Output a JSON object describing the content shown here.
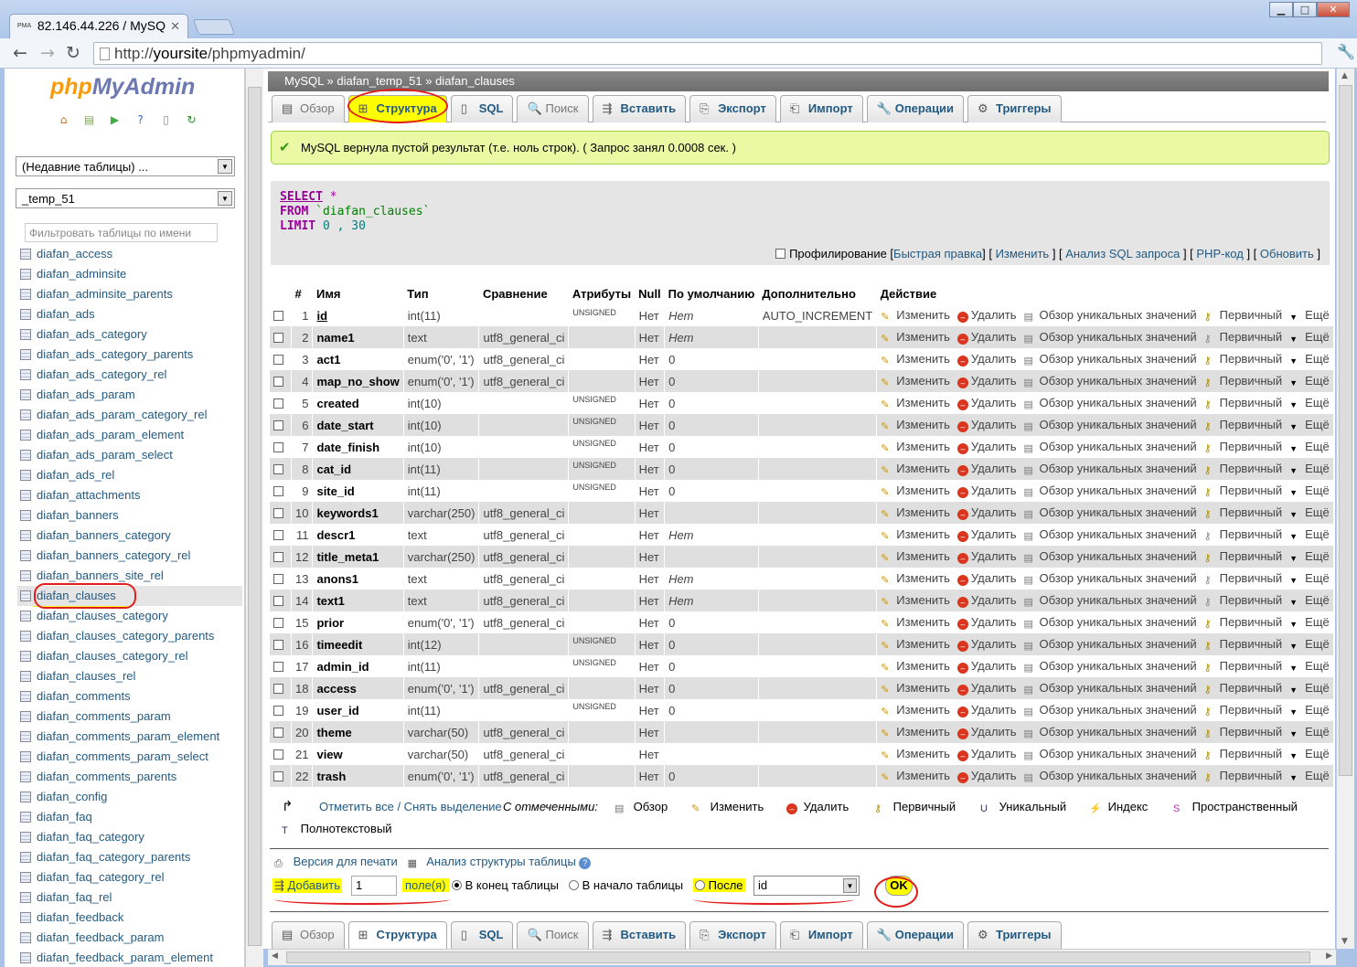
{
  "browser": {
    "tab_title": "82.146.44.226 / MySQ",
    "tab_favicon": "PMA",
    "url_prefix": "http://",
    "url_domain": "yoursite",
    "url_path": "/phpmyadmin/"
  },
  "sidebar": {
    "logo_php": "php",
    "logo_myadmin": "MyAdmin",
    "recent_select": "(Недавние таблицы) ...",
    "db_select": "_temp_51",
    "filter_placeholder": "Фильтровать таблицы по имени",
    "tables": [
      "diafan_access",
      "diafan_adminsite",
      "diafan_adminsite_parents",
      "diafan_ads",
      "diafan_ads_category",
      "diafan_ads_category_parents",
      "diafan_ads_category_rel",
      "diafan_ads_param",
      "diafan_ads_param_category_rel",
      "diafan_ads_param_element",
      "diafan_ads_param_select",
      "diafan_ads_rel",
      "diafan_attachments",
      "diafan_banners",
      "diafan_banners_category",
      "diafan_banners_category_rel",
      "diafan_banners_site_rel",
      "diafan_clauses",
      "diafan_clauses_category",
      "diafan_clauses_category_parents",
      "diafan_clauses_category_rel",
      "diafan_clauses_rel",
      "diafan_comments",
      "diafan_comments_param",
      "diafan_comments_param_element",
      "diafan_comments_param_select",
      "diafan_comments_parents",
      "diafan_config",
      "diafan_faq",
      "diafan_faq_category",
      "diafan_faq_category_parents",
      "diafan_faq_category_rel",
      "diafan_faq_rel",
      "diafan_feedback",
      "diafan_feedback_param",
      "diafan_feedback_param_element"
    ],
    "selected_table": "diafan_clauses"
  },
  "breadcrumb": {
    "server": "MySQL",
    "db": "diafan_temp_51",
    "table": "diafan_clauses",
    "sep": "»"
  },
  "tabs": [
    {
      "label": "Обзор",
      "icon": "browse-icon",
      "disabled": true
    },
    {
      "label": "Структура",
      "icon": "structure-icon",
      "active": true
    },
    {
      "label": "SQL",
      "icon": "sql-icon"
    },
    {
      "label": "Поиск",
      "icon": "search-icon",
      "disabled": true
    },
    {
      "label": "Вставить",
      "icon": "insert-icon"
    },
    {
      "label": "Экспорт",
      "icon": "export-icon"
    },
    {
      "label": "Импорт",
      "icon": "import-icon"
    },
    {
      "label": "Операции",
      "icon": "operations-icon"
    },
    {
      "label": "Триггеры",
      "icon": "triggers-icon"
    }
  ],
  "message": "MySQL вернула пустой результат (т.е. ноль строк). ( Запрос занял 0.0008 сек. )",
  "sql": {
    "kw_select": "SELECT",
    "star": " *",
    "kw_from": "FROM",
    "table": " `diafan_clauses`",
    "kw_limit": "LIMIT",
    "limit": " 0 , 30",
    "profiling": "Профилирование",
    "links": [
      "Быстрая правка",
      "Изменить",
      "Анализ SQL запроса",
      "PHP-код",
      "Обновить"
    ]
  },
  "table_headers": [
    "#",
    "Имя",
    "Тип",
    "Сравнение",
    "Атрибуты",
    "Null",
    "По умолчанию",
    "Дополнительно",
    "Действие"
  ],
  "columns": [
    {
      "n": "1",
      "name": "id",
      "type": "int(11)",
      "coll": "",
      "attr": "UNSIGNED",
      "null": "Нет",
      "def": "Нет",
      "extra": "AUTO_INCREMENT"
    },
    {
      "n": "2",
      "name": "name1",
      "type": "text",
      "coll": "utf8_general_ci",
      "attr": "",
      "null": "Нет",
      "def": "Нет",
      "extra": ""
    },
    {
      "n": "3",
      "name": "act1",
      "type": "enum('0', '1')",
      "coll": "utf8_general_ci",
      "attr": "",
      "null": "Нет",
      "def": "0",
      "extra": ""
    },
    {
      "n": "4",
      "name": "map_no_show",
      "type": "enum('0', '1')",
      "coll": "utf8_general_ci",
      "attr": "",
      "null": "Нет",
      "def": "0",
      "extra": ""
    },
    {
      "n": "5",
      "name": "created",
      "type": "int(10)",
      "coll": "",
      "attr": "UNSIGNED",
      "null": "Нет",
      "def": "0",
      "extra": ""
    },
    {
      "n": "6",
      "name": "date_start",
      "type": "int(10)",
      "coll": "",
      "attr": "UNSIGNED",
      "null": "Нет",
      "def": "0",
      "extra": ""
    },
    {
      "n": "7",
      "name": "date_finish",
      "type": "int(10)",
      "coll": "",
      "attr": "UNSIGNED",
      "null": "Нет",
      "def": "0",
      "extra": ""
    },
    {
      "n": "8",
      "name": "cat_id",
      "type": "int(11)",
      "coll": "",
      "attr": "UNSIGNED",
      "null": "Нет",
      "def": "0",
      "extra": ""
    },
    {
      "n": "9",
      "name": "site_id",
      "type": "int(11)",
      "coll": "",
      "attr": "UNSIGNED",
      "null": "Нет",
      "def": "0",
      "extra": ""
    },
    {
      "n": "10",
      "name": "keywords1",
      "type": "varchar(250)",
      "coll": "utf8_general_ci",
      "attr": "",
      "null": "Нет",
      "def": "",
      "extra": ""
    },
    {
      "n": "11",
      "name": "descr1",
      "type": "text",
      "coll": "utf8_general_ci",
      "attr": "",
      "null": "Нет",
      "def": "Нет",
      "extra": ""
    },
    {
      "n": "12",
      "name": "title_meta1",
      "type": "varchar(250)",
      "coll": "utf8_general_ci",
      "attr": "",
      "null": "Нет",
      "def": "",
      "extra": ""
    },
    {
      "n": "13",
      "name": "anons1",
      "type": "text",
      "coll": "utf8_general_ci",
      "attr": "",
      "null": "Нет",
      "def": "Нет",
      "extra": ""
    },
    {
      "n": "14",
      "name": "text1",
      "type": "text",
      "coll": "utf8_general_ci",
      "attr": "",
      "null": "Нет",
      "def": "Нет",
      "extra": ""
    },
    {
      "n": "15",
      "name": "prior",
      "type": "enum('0', '1')",
      "coll": "utf8_general_ci",
      "attr": "",
      "null": "Нет",
      "def": "0",
      "extra": ""
    },
    {
      "n": "16",
      "name": "timeedit",
      "type": "int(12)",
      "coll": "",
      "attr": "UNSIGNED",
      "null": "Нет",
      "def": "0",
      "extra": ""
    },
    {
      "n": "17",
      "name": "admin_id",
      "type": "int(11)",
      "coll": "",
      "attr": "UNSIGNED",
      "null": "Нет",
      "def": "0",
      "extra": ""
    },
    {
      "n": "18",
      "name": "access",
      "type": "enum('0', '1')",
      "coll": "utf8_general_ci",
      "attr": "",
      "null": "Нет",
      "def": "0",
      "extra": ""
    },
    {
      "n": "19",
      "name": "user_id",
      "type": "int(11)",
      "coll": "",
      "attr": "UNSIGNED",
      "null": "Нет",
      "def": "0",
      "extra": ""
    },
    {
      "n": "20",
      "name": "theme",
      "type": "varchar(50)",
      "coll": "utf8_general_ci",
      "attr": "",
      "null": "Нет",
      "def": "",
      "extra": ""
    },
    {
      "n": "21",
      "name": "view",
      "type": "varchar(50)",
      "coll": "utf8_general_ci",
      "attr": "",
      "null": "Нет",
      "def": "",
      "extra": ""
    },
    {
      "n": "22",
      "name": "trash",
      "type": "enum('0', '1')",
      "coll": "utf8_general_ci",
      "attr": "",
      "null": "Нет",
      "def": "0",
      "extra": ""
    }
  ],
  "row_actions": {
    "edit": "Изменить",
    "delete": "Удалить",
    "distinct": "Обзор уникальных значений",
    "primary": "Первичный",
    "more": "Ещё"
  },
  "bulk": {
    "check_all": "Отметить все / Снять выделение",
    "with_selected": "С отмеченными:",
    "ops": [
      "Обзор",
      "Изменить",
      "Удалить",
      "Первичный",
      "Уникальный",
      "Индекс",
      "Пространственный",
      "Полнотекстовый"
    ]
  },
  "footer_links": {
    "print": "Версия для печати",
    "analyze": "Анализ структуры таблицы"
  },
  "add_field": {
    "label": "Добавить",
    "count": "1",
    "unit": "поле(я)",
    "at_end": "В конец таблицы",
    "at_start": "В начало таблицы",
    "after": "После",
    "after_col": "id",
    "ok": "OK"
  },
  "colors": {
    "link": "#235a81",
    "highlight": "#ffff00",
    "annotation": "#e31c1c",
    "success_bg": "#ebf8a4"
  }
}
